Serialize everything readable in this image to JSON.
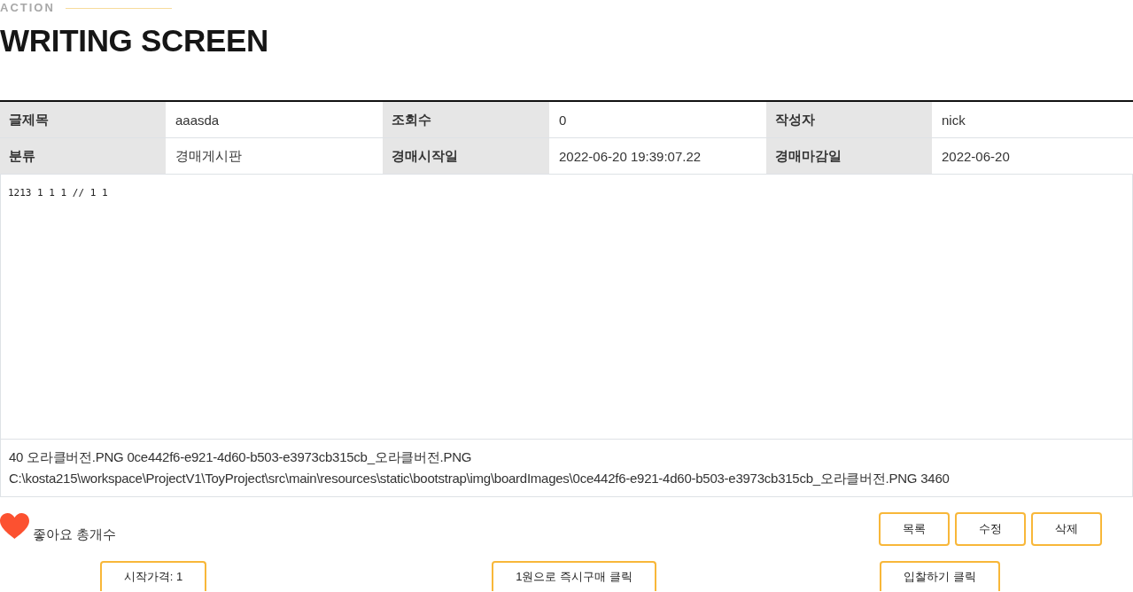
{
  "header": {
    "eyebrow": "ACTION",
    "title": "WRITING SCREEN"
  },
  "details": {
    "rows": [
      [
        {
          "label": "글제목",
          "value": "aaasda"
        },
        {
          "label": "조회수",
          "value": "0"
        },
        {
          "label": "작성자",
          "value": "nick"
        }
      ],
      [
        {
          "label": "분류",
          "value": "경매게시판"
        },
        {
          "label": "경매시작일",
          "value": "2022-06-20 19:39:07.22"
        },
        {
          "label": "경매마감일",
          "value": "2022-06-20"
        }
      ]
    ]
  },
  "content": "1213 1 1 1 // 1 1",
  "attachment": {
    "lines": [
      "40 오라클버전.PNG 0ce442f6-e921-4d60-b503-e3973cb315cb_오라클버전.PNG",
      "C:\\kosta215\\workspace\\ProjectV1\\ToyProject\\src\\main\\resources\\static\\bootstrap\\img\\boardImages\\0ce442f6-e921-4d60-b503-e3973cb315cb_오라클버전.PNG 3460"
    ]
  },
  "like": {
    "label": "좋아요 총개수"
  },
  "actions": [
    "목록",
    "수정",
    "삭제"
  ],
  "auction_buttons": [
    "시작가격: 1",
    "1원으로 즉시구매 클릭",
    "입찰하기 클릭"
  ]
}
